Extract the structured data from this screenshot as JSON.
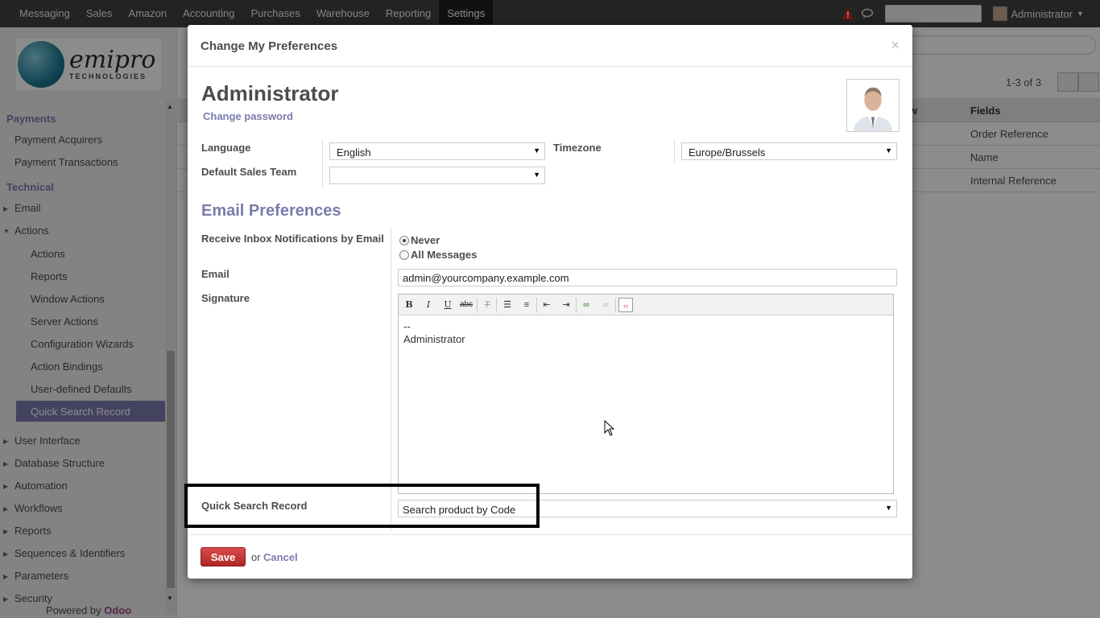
{
  "topbar": {
    "menu": [
      "Messaging",
      "Sales",
      "Amazon",
      "Accounting",
      "Purchases",
      "Warehouse",
      "Reporting",
      "Settings"
    ],
    "active_menu": "Settings",
    "user_name": "Administrator"
  },
  "sidebar": {
    "logo": {
      "name": "emipro",
      "sub": "TECHNOLOGIES"
    },
    "sections": [
      {
        "header": "Payments",
        "items": [
          "Payment Acquirers",
          "Payment Transactions"
        ]
      },
      {
        "header": "Technical"
      }
    ],
    "technical_items": {
      "email": "Email",
      "actions": "Actions",
      "actions_children": [
        "Actions",
        "Reports",
        "Window Actions",
        "Server Actions",
        "Configuration Wizards",
        "Action Bindings",
        "User-defined Defaults",
        "Quick Search Record"
      ],
      "collapsed": [
        "User Interface",
        "Database Structure",
        "Automation",
        "Workflows",
        "Reports",
        "Sequences & Identifiers",
        "Parameters",
        "Security"
      ]
    },
    "powered_by": "Powered by",
    "powered_brand": "Odoo"
  },
  "background_list": {
    "count": "1-3 of 3",
    "col_w": "w",
    "col_fields": "Fields",
    "rows": [
      "Order Reference",
      "Name",
      "Internal Reference"
    ]
  },
  "modal": {
    "title": "Change My Preferences",
    "close": "×",
    "record_name": "Administrator",
    "change_password": "Change password",
    "language_label": "Language",
    "language_value": "English",
    "timezone_label": "Timezone",
    "timezone_value": "Europe/Brussels",
    "sales_team_label": "Default Sales Team",
    "sales_team_value": "",
    "email_section": "Email Preferences",
    "inbox_label": "Receive Inbox Notifications by Email",
    "radio_options": [
      "Never",
      "All Messages"
    ],
    "radio_selected": "Never",
    "email_label": "Email",
    "email_value": "admin@yourcompany.example.com",
    "signature_label": "Signature",
    "signature_lines": [
      "--",
      "Administrator"
    ],
    "quick_search_label": "Quick Search Record",
    "quick_search_value": "Search product by Code",
    "save": "Save",
    "or": "or",
    "cancel": "Cancel"
  },
  "colors": {
    "topbar": "#414141",
    "accent": "#7c7bad",
    "save": "#c0392b",
    "brand": "#a24689"
  }
}
